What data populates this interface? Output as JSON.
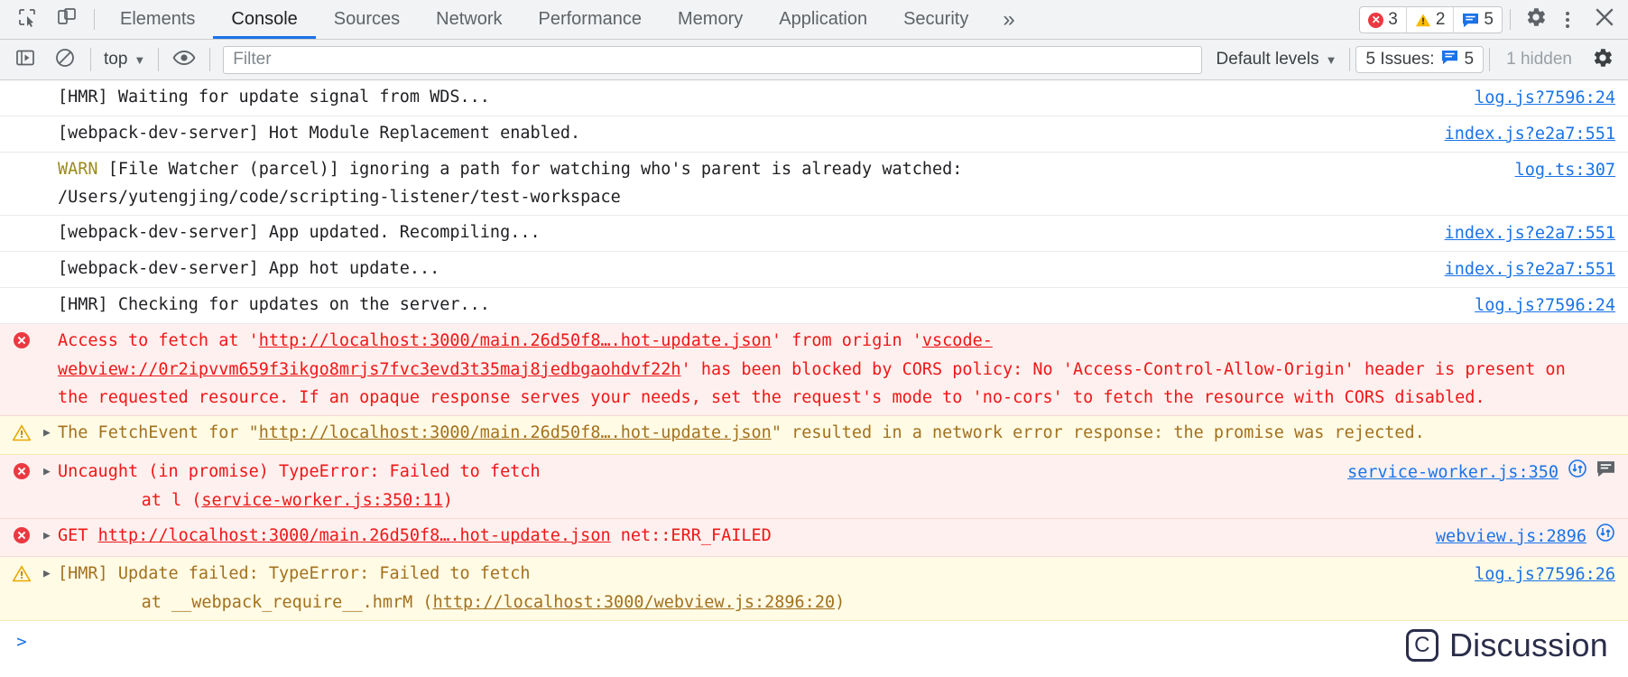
{
  "window": {
    "title": "Chrome DevTools - Console"
  },
  "toolbar": {
    "icons": {
      "inspect": "inspect-element-icon",
      "device": "device-toolbar-icon",
      "settings": "gear-icon",
      "kebab": "more-options-icon",
      "close": "close-icon",
      "more_tabs": "chevron-double-right-icon"
    },
    "tabs": [
      {
        "label": "Elements",
        "active": false
      },
      {
        "label": "Console",
        "active": true
      },
      {
        "label": "Sources",
        "active": false
      },
      {
        "label": "Network",
        "active": false
      },
      {
        "label": "Performance",
        "active": false
      },
      {
        "label": "Memory",
        "active": false
      },
      {
        "label": "Application",
        "active": false
      },
      {
        "label": "Security",
        "active": false
      }
    ],
    "more_tabs_label": "»",
    "counters": {
      "error_count": "3",
      "warning_count": "2",
      "message_count": "5"
    }
  },
  "filterbar": {
    "sidebar_toggle": "console-sidebar-icon",
    "clear_console": "clear-console-icon",
    "context_selector": "top",
    "eye_icon": "live-expression-icon",
    "filter": {
      "value": "",
      "placeholder": "Filter"
    },
    "levels_selector": "Default levels",
    "issues_label": "5 Issues:",
    "issues_count": "5",
    "hidden_label": "1 hidden",
    "settings_icon": "gear-icon"
  },
  "console": {
    "rows": [
      {
        "level": "info",
        "expandable": false,
        "text": "[HMR] Waiting for update signal from WDS...",
        "source": "log.js?7596:24"
      },
      {
        "level": "info",
        "expandable": false,
        "text": "[webpack-dev-server] Hot Module Replacement enabled.",
        "source": "index.js?e2a7:551"
      },
      {
        "level": "info",
        "expandable": false,
        "warn_tag": "WARN",
        "text": " [File Watcher (parcel)] ignoring a path for watching who's parent is already watched:\n/Users/yutengjing/code/scripting-listener/test-workspace",
        "source": "log.ts:307"
      },
      {
        "level": "info",
        "expandable": false,
        "text": "[webpack-dev-server] App updated. Recompiling...",
        "source": "index.js?e2a7:551"
      },
      {
        "level": "info",
        "expandable": false,
        "text": "[webpack-dev-server] App hot update...",
        "source": "index.js?e2a7:551"
      },
      {
        "level": "info",
        "expandable": false,
        "text": "[HMR] Checking for updates on the server...",
        "source": "log.js?7596:24"
      },
      {
        "level": "error",
        "expandable": false,
        "icon": "error-circle-icon",
        "segments": [
          {
            "t": "Access to fetch at '",
            "link": false
          },
          {
            "t": "http://localhost:3000/main.26d50f8….hot-update.json",
            "link": true
          },
          {
            "t": "' from origin '",
            "link": false
          },
          {
            "t": "vscode-webview://0r2ipvvm659f3ikgo8mrjs7fvc3evd3t35maj8jedbgaohdvf22h",
            "link": true
          },
          {
            "t": "' has been blocked by CORS policy: No 'Access-Control-Allow-Origin' header is present on the requested resource. If an opaque response serves your needs, set the request's mode to 'no-cors' to fetch the resource with CORS disabled.",
            "link": false
          }
        ],
        "source": ""
      },
      {
        "level": "warning",
        "expandable": true,
        "icon": "warning-triangle-icon",
        "segments": [
          {
            "t": "The FetchEvent for \"",
            "link": false
          },
          {
            "t": "http://localhost:3000/main.26d50f8….hot-update.json",
            "link": true
          },
          {
            "t": "\" resulted in a network error response: the promise was rejected.",
            "link": false
          }
        ],
        "source": ""
      },
      {
        "level": "error",
        "expandable": true,
        "icon": "error-circle-icon",
        "segments": [
          {
            "t": "Uncaught (in promise) TypeError: Failed to fetch",
            "link": false
          }
        ],
        "stack": [
          {
            "prefix": "    at l (",
            "link": "service-worker.js:350:11",
            "suffix": ")"
          }
        ],
        "source": "service-worker.js:350",
        "has_network_icon": true,
        "has_issue_icon": true
      },
      {
        "level": "error",
        "expandable": true,
        "icon": "error-circle-icon",
        "segments": [
          {
            "t": "GET ",
            "link": false
          },
          {
            "t": "http://localhost:3000/main.26d50f8….hot-update.json",
            "link": true
          },
          {
            "t": " net::ERR_FAILED",
            "link": false
          }
        ],
        "source": "webview.js:2896",
        "has_network_icon": true
      },
      {
        "level": "warning",
        "expandable": true,
        "icon": "warning-triangle-icon",
        "segments": [
          {
            "t": "[HMR] Update failed: TypeError: Failed to fetch",
            "link": false
          }
        ],
        "stack": [
          {
            "prefix": "    at __webpack_require__.hmrM (",
            "link": "http://localhost:3000/webview.js:2896:20",
            "suffix": ")"
          }
        ],
        "source": "log.js?7596:26"
      }
    ],
    "prompt_caret": ">"
  },
  "watermark": {
    "logo": "C",
    "label": "Discussion"
  },
  "colors": {
    "accent": "#1a73e8",
    "error_text": "#f01717",
    "error_bg": "#fdf0ef",
    "warning_text": "#a3711d",
    "warning_bg": "#fffbe5",
    "toolbar_bg": "#f1f3f4",
    "warn_tag": "#9a8b1e"
  }
}
